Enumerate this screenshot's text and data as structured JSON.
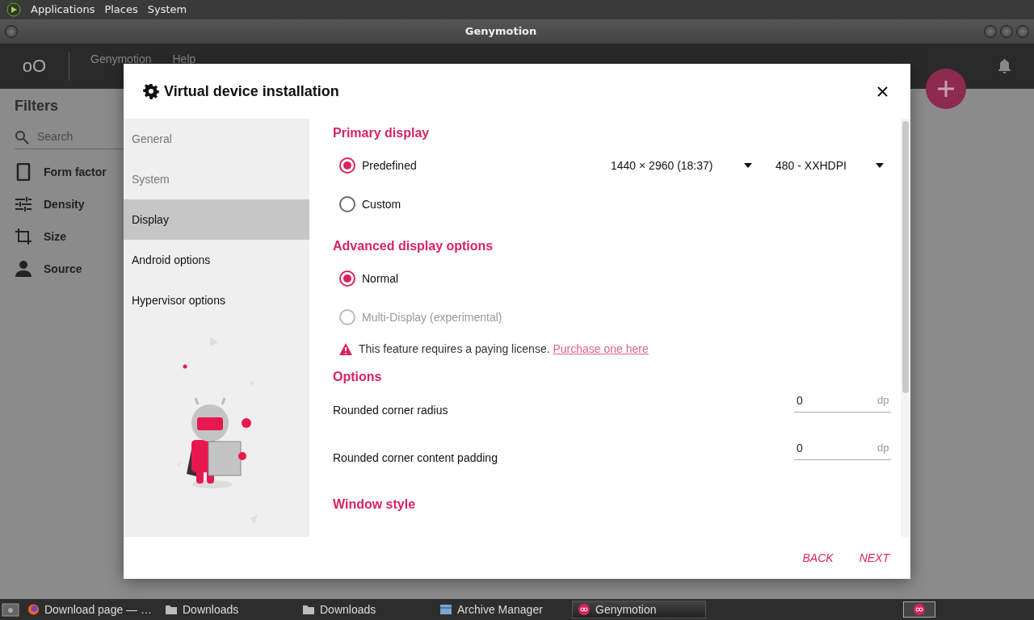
{
  "top_panel": {
    "menus": [
      "Applications",
      "Places",
      "System"
    ]
  },
  "window": {
    "title": "Genymotion"
  },
  "toolbar": {
    "logo": "oO",
    "menus": [
      "Genymotion",
      "Help"
    ]
  },
  "filters": {
    "title": "Filters",
    "search": {
      "placeholder": "Search"
    },
    "items": [
      {
        "label": "Form factor",
        "kind": "phone"
      },
      {
        "label": "Density",
        "kind": "sliders"
      },
      {
        "label": "Size",
        "kind": "crop"
      },
      {
        "label": "Source",
        "kind": "person"
      }
    ]
  },
  "dialog": {
    "title": "Virtual device installation",
    "nav": [
      {
        "label": "General",
        "selected": false,
        "disabled": true
      },
      {
        "label": "System",
        "selected": false,
        "disabled": true
      },
      {
        "label": "Display",
        "selected": true,
        "disabled": false
      },
      {
        "label": "Android options",
        "selected": false,
        "disabled": false
      },
      {
        "label": "Hypervisor options",
        "selected": false,
        "disabled": false
      }
    ],
    "primary_display": {
      "heading": "Primary display",
      "options": [
        {
          "label": "Predefined",
          "selected": true,
          "disabled": false
        },
        {
          "label": "Custom",
          "selected": false,
          "disabled": false
        }
      ],
      "resolution": "1440 × 2960 (18:37)",
      "density": "480 - XXHDPI"
    },
    "advanced": {
      "heading": "Advanced display options",
      "options": [
        {
          "label": "Normal",
          "selected": true,
          "disabled": false
        },
        {
          "label": "Multi-Display (experimental)",
          "selected": false,
          "disabled": true
        }
      ],
      "notice": {
        "text": "This feature requires a paying license.",
        "link": "Purchase one here"
      }
    },
    "options": {
      "heading": "Options",
      "fields": [
        {
          "label": "Rounded corner radius",
          "value": "0",
          "unit": "dp"
        },
        {
          "label": "Rounded corner content padding",
          "value": "0",
          "unit": "dp"
        }
      ]
    },
    "window_style": {
      "heading": "Window style"
    },
    "buttons": [
      "BACK",
      "NEXT"
    ]
  },
  "taskbar": {
    "items": [
      {
        "label": "Download page — …",
        "kind": "browser",
        "selected": false
      },
      {
        "label": "Downloads",
        "kind": "folder",
        "selected": false
      },
      {
        "label": "Downloads",
        "kind": "folder",
        "selected": false
      },
      {
        "label": "Archive Manager",
        "kind": "archive",
        "selected": false
      },
      {
        "label": "Genymotion",
        "kind": "app",
        "selected": true
      }
    ]
  }
}
